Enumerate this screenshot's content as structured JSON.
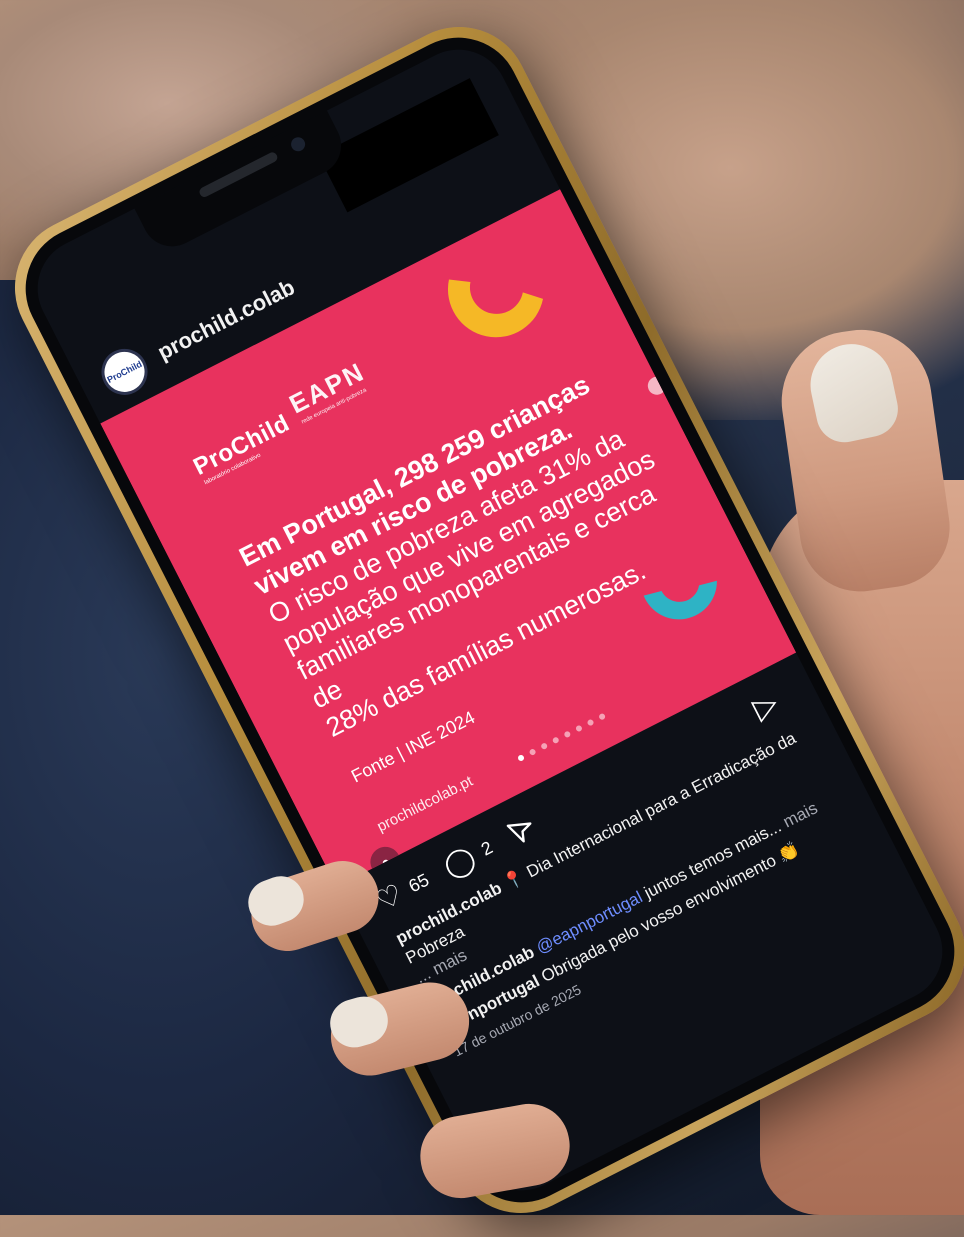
{
  "instagram": {
    "username": "prochild.colab",
    "avatar_text": "ProChild"
  },
  "post": {
    "logo_prochild": "ProChild",
    "logo_prochild_sub": "laboratório colaborativo",
    "logo_eapn": "EAPN",
    "logo_eapn_sub": "rede europeia anti-pobreza",
    "headline_line1": "Em Portugal, 298 259 crianças",
    "headline_line2": "vivem em risco de pobreza.",
    "body_line1": "O risco de pobreza afeta 31% da",
    "body_line2": "população que vive em agregados",
    "body_line3": "familiares monoparentais e cerca de",
    "body_line4": "28% das famílias numerosas.",
    "source": "Fonte | INE 2024",
    "url": "prochildcolab.pt",
    "carousel_total": 8,
    "carousel_active": 1,
    "colors": {
      "background": "#e8325e",
      "yellow": "#f5b826",
      "teal": "#2eb3c5"
    }
  },
  "actions": {
    "likes": "65",
    "comments": "2"
  },
  "caption": {
    "user": "prochild.colab",
    "pin": "📍",
    "text": "Dia Internacional para a Erradicação da Pobreza",
    "more": "... mais"
  },
  "comments": [
    {
      "user": "prochild.colab",
      "mention": "@eapnportugal",
      "text": " juntos temos mais...",
      "more": "mais"
    },
    {
      "user": "eapnportugal",
      "text": "Obrigada pelo vosso envolvimento",
      "emoji": "👏"
    }
  ],
  "date": "17 de outubro de 2025"
}
